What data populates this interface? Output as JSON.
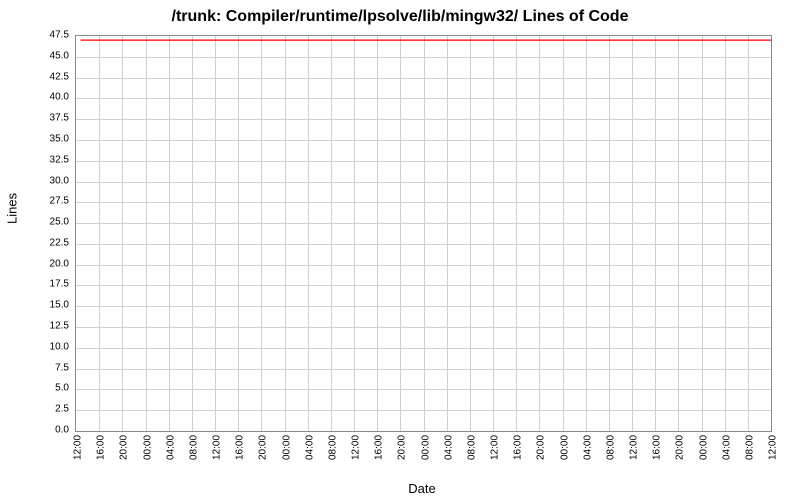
{
  "chart_data": {
    "type": "line",
    "title": "/trunk: Compiler/runtime/lpsolve/lib/mingw32/ Lines of Code",
    "xlabel": "Date",
    "ylabel": "Lines",
    "ylim": [
      0.0,
      47.5
    ],
    "y_ticks": [
      0.0,
      2.5,
      5.0,
      7.5,
      10.0,
      12.5,
      15.0,
      17.5,
      20.0,
      22.5,
      25.0,
      27.5,
      30.0,
      32.5,
      35.0,
      37.5,
      40.0,
      42.5,
      45.0,
      47.5
    ],
    "x_ticks": [
      "12:00",
      "16:00",
      "20:00",
      "00:00",
      "04:00",
      "08:00",
      "12:00",
      "16:00",
      "20:00",
      "00:00",
      "04:00",
      "08:00",
      "12:00",
      "16:00",
      "20:00",
      "00:00",
      "04:00",
      "08:00",
      "12:00",
      "16:00",
      "20:00",
      "00:00",
      "04:00",
      "08:00",
      "12:00",
      "16:00",
      "20:00",
      "00:00",
      "04:00",
      "08:00",
      "12:00"
    ],
    "series": [
      {
        "name": "Lines of Code",
        "color": "#ff0000",
        "x_indices": [
          0.2,
          30.2
        ],
        "values": [
          47,
          47
        ]
      }
    ]
  }
}
